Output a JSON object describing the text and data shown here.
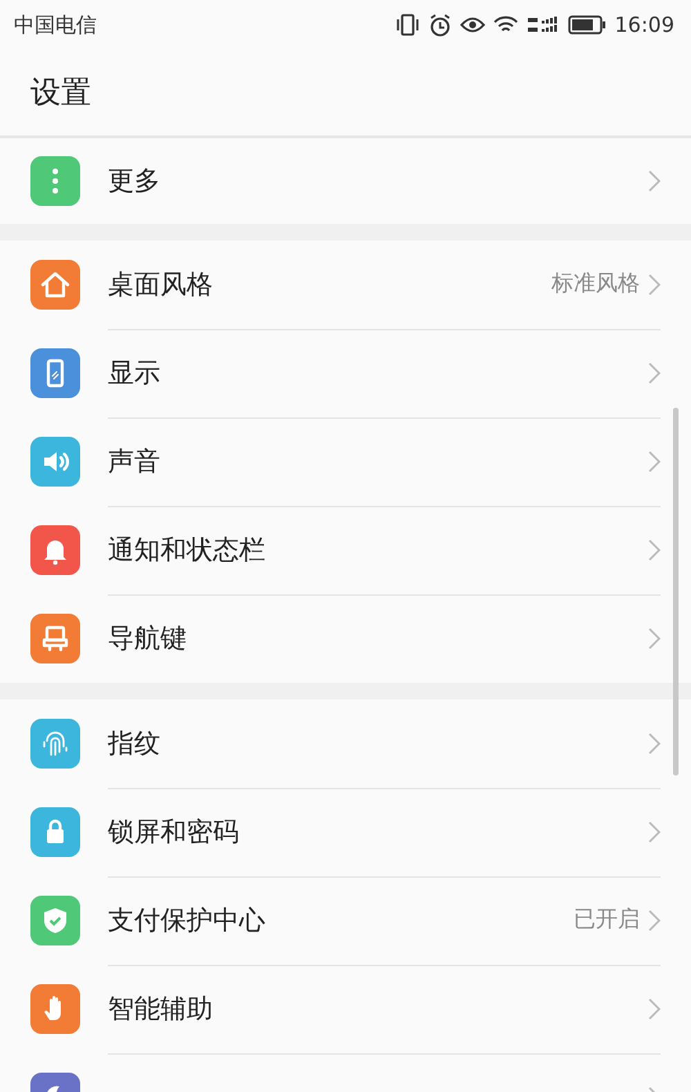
{
  "status_bar": {
    "carrier": "中国电信",
    "time": "16:09"
  },
  "header": {
    "title": "设置"
  },
  "groups": [
    {
      "items": [
        {
          "label": "更多",
          "color": "#4fc978"
        }
      ]
    },
    {
      "items": [
        {
          "label": "桌面风格",
          "value": "标准风格",
          "color": "#f27b35"
        },
        {
          "label": "显示",
          "color": "#4a90db"
        },
        {
          "label": "声音",
          "color": "#3cb6dc"
        },
        {
          "label": "通知和状态栏",
          "color": "#f2554a"
        },
        {
          "label": "导航键",
          "color": "#f27b35"
        }
      ]
    },
    {
      "items": [
        {
          "label": "指纹",
          "color": "#3cb6dc"
        },
        {
          "label": "锁屏和密码",
          "color": "#3cb6dc"
        },
        {
          "label": "支付保护中心",
          "value": "已开启",
          "color": "#4fc978"
        },
        {
          "label": "智能辅助",
          "color": "#f27b35"
        },
        {
          "color": "#6a72c8"
        }
      ]
    }
  ]
}
